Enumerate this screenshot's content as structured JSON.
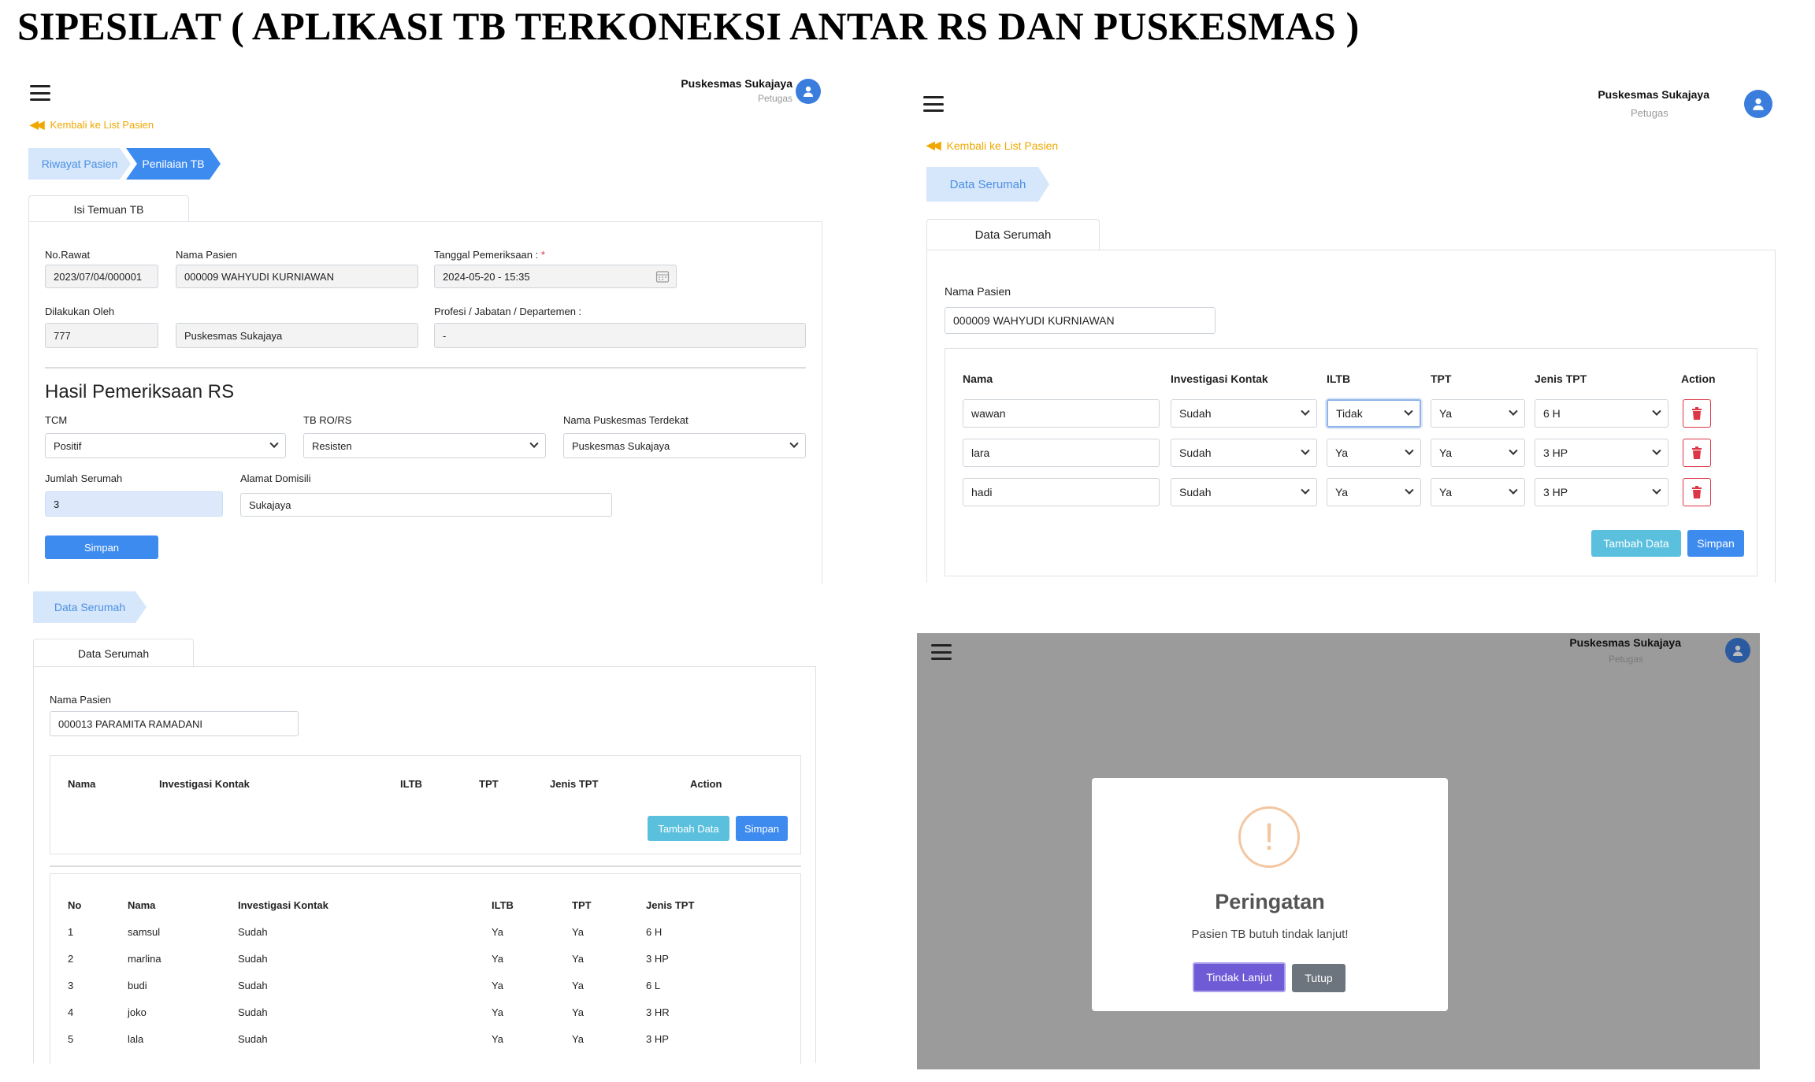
{
  "page_title": "SIPESILAT ( APLIKASI TB TERKONEKSI ANTAR RS DAN PUSKESMAS )",
  "user": {
    "name": "Puskesmas Sukajaya",
    "role": "Petugas"
  },
  "back_link": "Kembali ke List Pasien",
  "panel1": {
    "steps": [
      "Riwayat Pasien",
      "Penilaian TB"
    ],
    "tab": "Isi Temuan TB",
    "fields": {
      "no_rawat_label": "No.Rawat",
      "no_rawat": "2023/07/04/000001",
      "nama_pasien_label": "Nama Pasien",
      "nama_pasien": "000009 WAHYUDI KURNIAWAN",
      "tanggal_label": "Tanggal Pemeriksaan :",
      "required_mark": "*",
      "tanggal": "2024-05-20 - 15:35",
      "dilakukan_label": "Dilakukan Oleh",
      "dilakukan_id": "777",
      "dilakukan_nama": "Puskesmas Sukajaya",
      "profesi_label": "Profesi / Jabatan / Departemen :",
      "profesi": "-"
    },
    "section_title": "Hasil Pemeriksaan RS",
    "exam": {
      "tcm_label": "TCM",
      "tcm": "Positif",
      "tbro_label": "TB RO/RS",
      "tbro": "Resisten",
      "puskesmas_label": "Nama Puskesmas Terdekat",
      "puskesmas": "Puskesmas Sukajaya",
      "jumlah_label": "Jumlah Serumah",
      "jumlah": "3",
      "alamat_label": "Alamat Domisili",
      "alamat": "Sukajaya"
    },
    "save": "Simpan"
  },
  "panel2": {
    "step": "Data Serumah",
    "tab": "Data Serumah",
    "nama_label": "Nama Pasien",
    "nama": "000009 WAHYUDI KURNIAWAN",
    "headers": [
      "Nama",
      "Investigasi Kontak",
      "ILTB",
      "TPT",
      "Jenis TPT",
      "Action"
    ],
    "rows": [
      {
        "nama": "wawan",
        "inv": "Sudah",
        "iltb": "Tidak",
        "tpt": "Ya",
        "jenis": "6 H"
      },
      {
        "nama": "lara",
        "inv": "Sudah",
        "iltb": "Ya",
        "tpt": "Ya",
        "jenis": "3 HP"
      },
      {
        "nama": "hadi",
        "inv": "Sudah",
        "iltb": "Ya",
        "tpt": "Ya",
        "jenis": "3 HP"
      }
    ],
    "add": "Tambah Data",
    "save": "Simpan"
  },
  "panel3": {
    "step": "Data Serumah",
    "tab": "Data Serumah",
    "nama_label": "Nama Pasien",
    "nama": "000013 PARAMITA RAMADANI",
    "headers": [
      "Nama",
      "Investigasi Kontak",
      "ILTB",
      "TPT",
      "Jenis TPT",
      "Action"
    ],
    "add": "Tambah Data",
    "save": "Simpan",
    "list_headers": [
      "No",
      "Nama",
      "Investigasi Kontak",
      "ILTB",
      "TPT",
      "Jenis TPT"
    ],
    "list": [
      {
        "no": "1",
        "nama": "samsul",
        "inv": "Sudah",
        "iltb": "Ya",
        "tpt": "Ya",
        "jenis": "6 H"
      },
      {
        "no": "2",
        "nama": "marlina",
        "inv": "Sudah",
        "iltb": "Ya",
        "tpt": "Ya",
        "jenis": "3 HP"
      },
      {
        "no": "3",
        "nama": "budi",
        "inv": "Sudah",
        "iltb": "Ya",
        "tpt": "Ya",
        "jenis": "6 L"
      },
      {
        "no": "4",
        "nama": "joko",
        "inv": "Sudah",
        "iltb": "Ya",
        "tpt": "Ya",
        "jenis": "3 HR"
      },
      {
        "no": "5",
        "nama": "lala",
        "inv": "Sudah",
        "iltb": "Ya",
        "tpt": "Ya",
        "jenis": "3 HP"
      }
    ]
  },
  "modal": {
    "icon": "!",
    "title": "Peringatan",
    "message": "Pasien TB butuh tindak lanjut!",
    "confirm": "Tindak Lanjut",
    "cancel": "Tutup"
  },
  "colors": {
    "primary": "#3d8bef",
    "info": "#5bc0de",
    "warning": "#f0a800",
    "danger": "#dc3545",
    "overlay": "#9b9b9b",
    "confirm": "#6f5bd6"
  }
}
